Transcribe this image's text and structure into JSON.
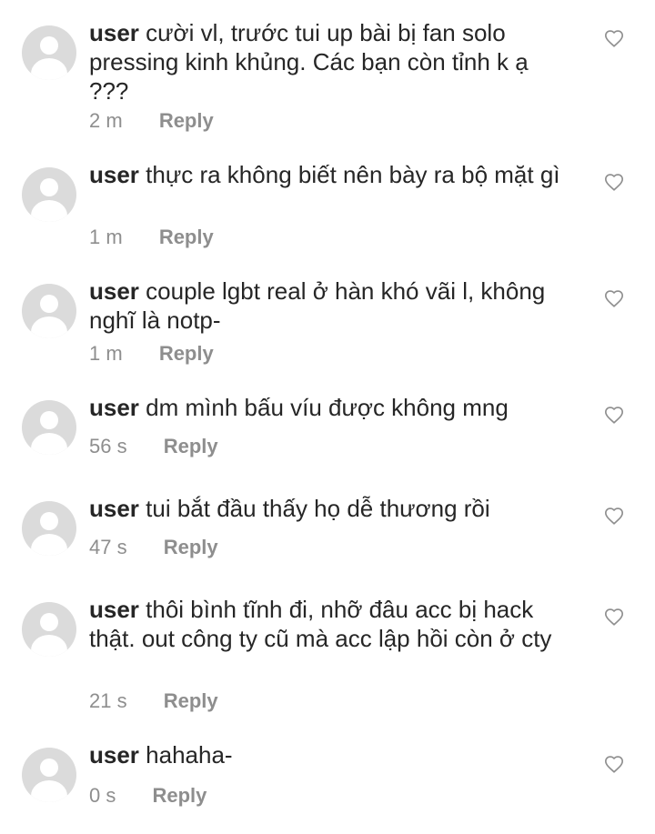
{
  "comments": [
    {
      "username": "user",
      "text": "cười vl, trước tui up bài bị fan solo pressing kinh khủng. Các bạn còn tỉnh k ạ ???",
      "time": "2 m",
      "reply_label": "Reply"
    },
    {
      "username": "user",
      "text": "thực ra không biết nên bày ra bộ mặt gì",
      "time": "1 m",
      "reply_label": "Reply"
    },
    {
      "username": "user",
      "text": "couple lgbt real ở hàn khó vãi l, không nghĩ là notp-",
      "time": "1 m",
      "reply_label": "Reply"
    },
    {
      "username": "user",
      "text": "dm mình bấu víu được không mng",
      "time": "56 s",
      "reply_label": "Reply"
    },
    {
      "username": "user",
      "text": "tui bắt đầu thấy họ dễ thương rồi",
      "time": "47 s",
      "reply_label": "Reply"
    },
    {
      "username": "user",
      "text": "thôi bình tĩnh đi, nhỡ đâu acc bị hack thật. out công ty cũ mà acc lập hồi còn ở cty",
      "time": "21 s",
      "reply_label": "Reply"
    },
    {
      "username": "user",
      "text": "hahaha-",
      "time": "0 s",
      "reply_label": "Reply"
    }
  ],
  "icons": {
    "avatar": "default-avatar-icon",
    "like": "heart-outline-icon"
  },
  "colors": {
    "text": "#262626",
    "secondary": "#8e8e8e",
    "avatar_bg": "#dbdbdb"
  }
}
